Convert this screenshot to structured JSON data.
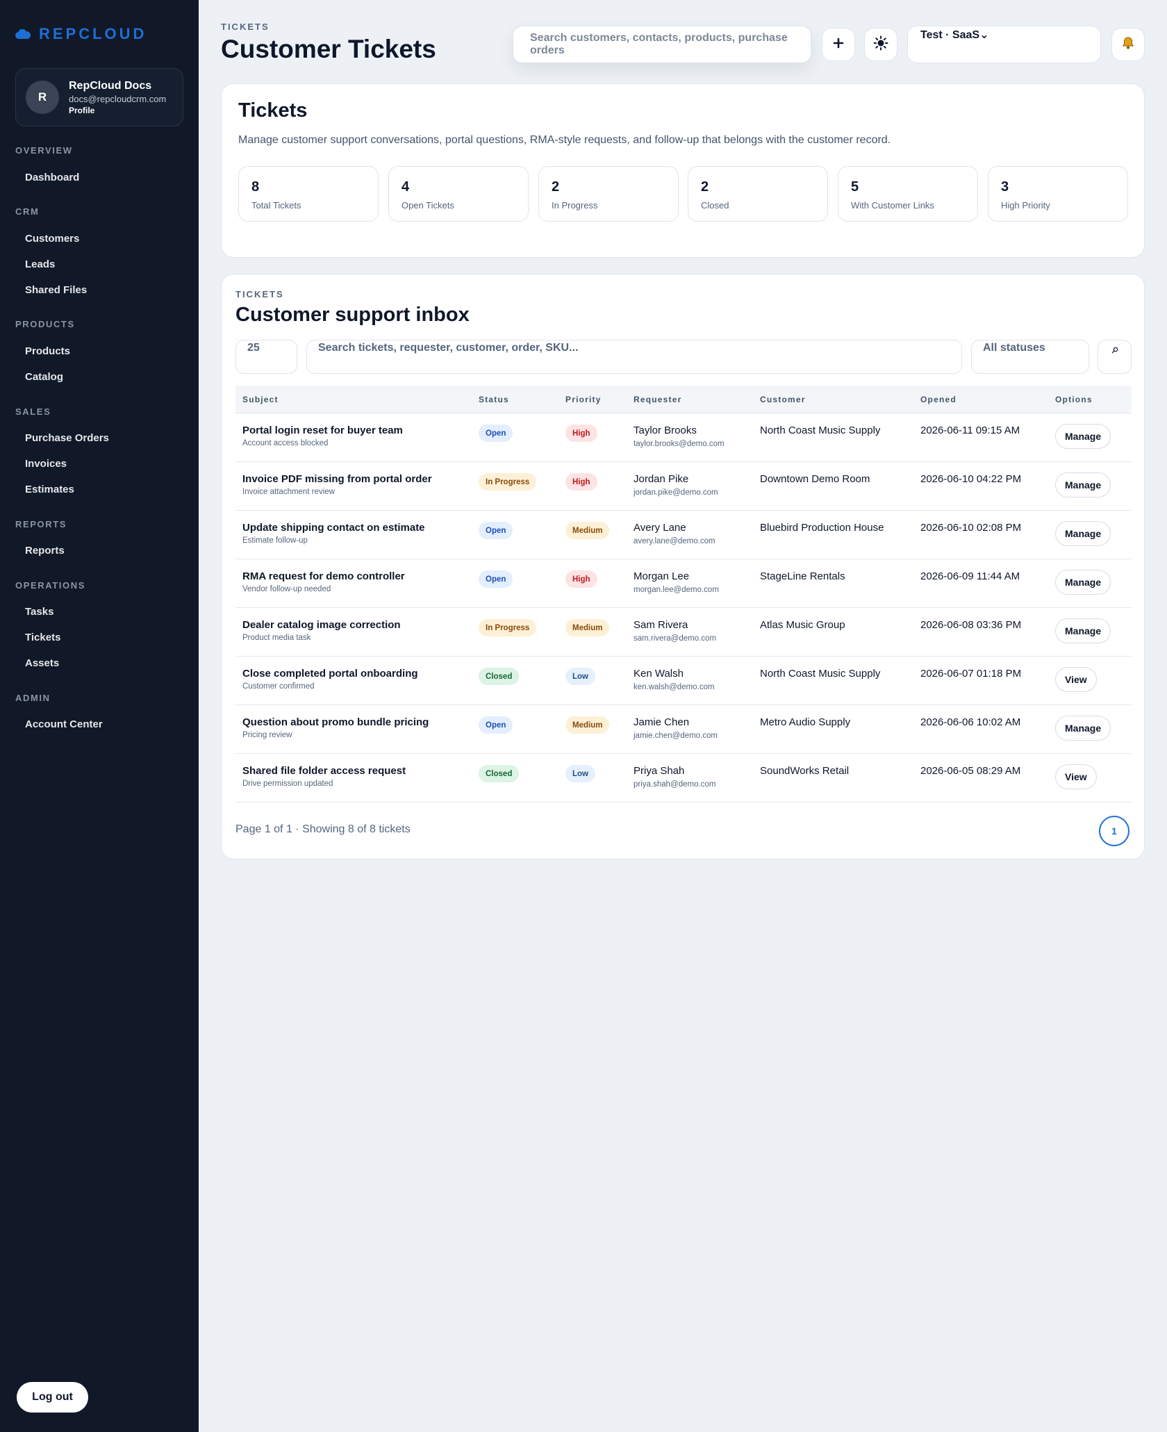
{
  "brand": {
    "name": "REPCLOUD",
    "color": "#1d6fd6"
  },
  "profile": {
    "initial": "R",
    "name": "RepCloud Docs",
    "email": "docs@repcloudcrm.com",
    "link": "Profile"
  },
  "sidebar": {
    "sections": [
      {
        "label": "OVERVIEW",
        "items": [
          "Dashboard"
        ]
      },
      {
        "label": "CRM",
        "items": [
          "Customers",
          "Leads",
          "Shared Files"
        ]
      },
      {
        "label": "PRODUCTS",
        "items": [
          "Products",
          "Catalog"
        ]
      },
      {
        "label": "SALES",
        "items": [
          "Purchase Orders",
          "Invoices",
          "Estimates"
        ]
      },
      {
        "label": "REPORTS",
        "items": [
          "Reports"
        ]
      },
      {
        "label": "OPERATIONS",
        "items": [
          "Tasks",
          "Tickets",
          "Assets"
        ]
      },
      {
        "label": "ADMIN",
        "items": [
          "Account Center"
        ]
      }
    ],
    "logout": "Log out"
  },
  "header": {
    "breadcrumb": "TICKETS",
    "title": "Customer Tickets",
    "search_placeholder": "Search customers, contacts, products, purchase orders",
    "add_icon": "plus-icon",
    "theme_icon": "sun-icon",
    "tenant": "Test · SaaS⌄",
    "notify_icon": "bell-icon"
  },
  "summary": {
    "title": "Tickets",
    "description": "Manage customer support conversations, portal questions, RMA-style requests, and follow-up that belongs with the customer record.",
    "stats": [
      {
        "value": "8",
        "label": "Total Tickets"
      },
      {
        "value": "4",
        "label": "Open Tickets"
      },
      {
        "value": "2",
        "label": "In Progress"
      },
      {
        "value": "2",
        "label": "Closed"
      },
      {
        "value": "5",
        "label": "With Customer Links"
      },
      {
        "value": "3",
        "label": "High Priority"
      }
    ]
  },
  "inbox": {
    "kicker": "TICKETS",
    "title": "Customer support inbox",
    "page_size": "25",
    "search_placeholder": "Search tickets, requester, customer, order, SKU...",
    "status_filter": "All statuses",
    "search_icon": "search-icon",
    "columns": [
      "Subject",
      "Status",
      "Priority",
      "Requester",
      "Customer",
      "Opened",
      "Options"
    ],
    "rows": [
      {
        "subject": "Portal login reset for buyer team",
        "sub": "Account access blocked",
        "status": "Open",
        "priority": "High",
        "requester": "Taylor Brooks",
        "email": "taylor.brooks@demo.com",
        "customer": "North Coast Music Supply",
        "opened": "2026-06-11 09:15 AM",
        "action": "Manage"
      },
      {
        "subject": "Invoice PDF missing from portal order",
        "sub": "Invoice attachment review",
        "status": "In Progress",
        "priority": "High",
        "requester": "Jordan Pike",
        "email": "jordan.pike@demo.com",
        "customer": "Downtown Demo Room",
        "opened": "2026-06-10 04:22 PM",
        "action": "Manage"
      },
      {
        "subject": "Update shipping contact on estimate",
        "sub": "Estimate follow-up",
        "status": "Open",
        "priority": "Medium",
        "requester": "Avery Lane",
        "email": "avery.lane@demo.com",
        "customer": "Bluebird Production House",
        "opened": "2026-06-10 02:08 PM",
        "action": "Manage"
      },
      {
        "subject": "RMA request for demo controller",
        "sub": "Vendor follow-up needed",
        "status": "Open",
        "priority": "High",
        "requester": "Morgan Lee",
        "email": "morgan.lee@demo.com",
        "customer": "StageLine Rentals",
        "opened": "2026-06-09 11:44 AM",
        "action": "Manage"
      },
      {
        "subject": "Dealer catalog image correction",
        "sub": "Product media task",
        "status": "In Progress",
        "priority": "Medium",
        "requester": "Sam Rivera",
        "email": "sam.rivera@demo.com",
        "customer": "Atlas Music Group",
        "opened": "2026-06-08 03:36 PM",
        "action": "Manage"
      },
      {
        "subject": "Close completed portal onboarding",
        "sub": "Customer confirmed",
        "status": "Closed",
        "priority": "Low",
        "requester": "Ken Walsh",
        "email": "ken.walsh@demo.com",
        "customer": "North Coast Music Supply",
        "opened": "2026-06-07 01:18 PM",
        "action": "View"
      },
      {
        "subject": "Question about promo bundle pricing",
        "sub": "Pricing review",
        "status": "Open",
        "priority": "Medium",
        "requester": "Jamie Chen",
        "email": "jamie.chen@demo.com",
        "customer": "Metro Audio Supply",
        "opened": "2026-06-06 10:02 AM",
        "action": "Manage"
      },
      {
        "subject": "Shared file folder access request",
        "sub": "Drive permission updated",
        "status": "Closed",
        "priority": "Low",
        "requester": "Priya Shah",
        "email": "priya.shah@demo.com",
        "customer": "SoundWorks Retail",
        "opened": "2026-06-05 08:29 AM",
        "action": "View"
      }
    ],
    "pager_text": "Page 1 of 1 · Showing 8 of 8 tickets",
    "current_page": "1"
  },
  "colors": {
    "status": {
      "Open": [
        "#e3eefe",
        "#1d4fb8"
      ],
      "In Progress": [
        "#fdf0d6",
        "#8a4a0b"
      ],
      "Closed": [
        "#dcf3e5",
        "#166534"
      ]
    },
    "priority": {
      "High": [
        "#fde3e3",
        "#b91c1c"
      ],
      "Medium": [
        "#fdf0d6",
        "#8a4a0b"
      ],
      "Low": [
        "#e6f0fb",
        "#1e4f88"
      ]
    }
  }
}
